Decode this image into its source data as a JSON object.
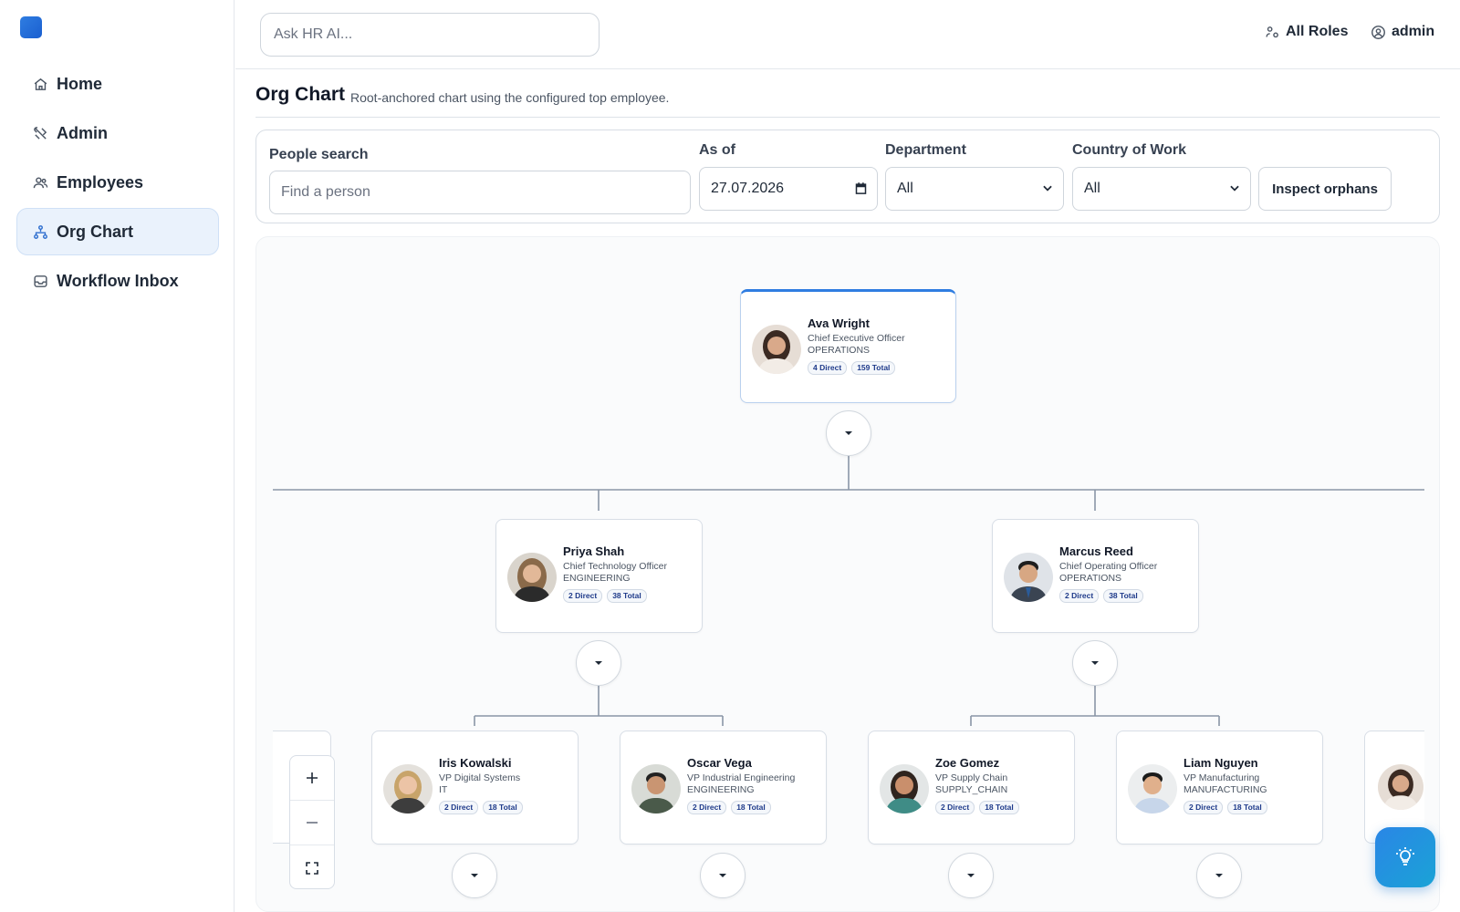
{
  "sidebar": {
    "items": [
      {
        "label": "Home",
        "icon": "home-icon",
        "active": false
      },
      {
        "label": "Admin",
        "icon": "tools-icon",
        "active": false
      },
      {
        "label": "Employees",
        "icon": "users-icon",
        "active": false
      },
      {
        "label": "Org Chart",
        "icon": "org-chart-icon",
        "active": true
      },
      {
        "label": "Workflow Inbox",
        "icon": "inbox-icon",
        "active": false
      }
    ]
  },
  "topbar": {
    "ai_placeholder": "Ask HR AI...",
    "roles_label": "All Roles",
    "user_label": "admin"
  },
  "page": {
    "title": "Org Chart",
    "subtitle": "Root-anchored chart using the configured top employee."
  },
  "filters": {
    "people_search_label": "People search",
    "people_search_placeholder": "Find a person",
    "as_of_label": "As of",
    "as_of_value": "27.07.2026",
    "department_label": "Department",
    "department_value": "All",
    "country_label": "Country of Work",
    "country_value": "All",
    "inspect_button": "Inspect orphans"
  },
  "org": {
    "root": {
      "name": "Ava Wright",
      "role": "Chief Executive Officer",
      "dept": "OPERATIONS",
      "direct": "4 Direct",
      "total": "159 Total"
    },
    "level1": [
      {
        "name": "Priya Shah",
        "role": "Chief Technology Officer",
        "dept": "ENGINEERING",
        "direct": "2 Direct",
        "total": "38 Total"
      },
      {
        "name": "Marcus Reed",
        "role": "Chief Operating Officer",
        "dept": "OPERATIONS",
        "direct": "2 Direct",
        "total": "38 Total"
      }
    ],
    "level2": [
      {
        "name": "Iris Kowalski",
        "role": "VP Digital Systems",
        "dept": "IT",
        "direct": "2 Direct",
        "total": "18 Total"
      },
      {
        "name": "Oscar Vega",
        "role": "VP Industrial Engineering",
        "dept": "ENGINEERING",
        "direct": "2 Direct",
        "total": "18 Total"
      },
      {
        "name": "Zoe Gomez",
        "role": "VP Supply Chain",
        "dept": "SUPPLY_CHAIN",
        "direct": "2 Direct",
        "total": "18 Total"
      },
      {
        "name": "Liam Nguyen",
        "role": "VP Manufacturing",
        "dept": "MANUFACTURING",
        "direct": "2 Direct",
        "total": "18 Total"
      }
    ]
  },
  "colors": {
    "accent": "#2f7de1",
    "active_bg": "#eaf2fc",
    "fab": "#1a9ad8"
  }
}
